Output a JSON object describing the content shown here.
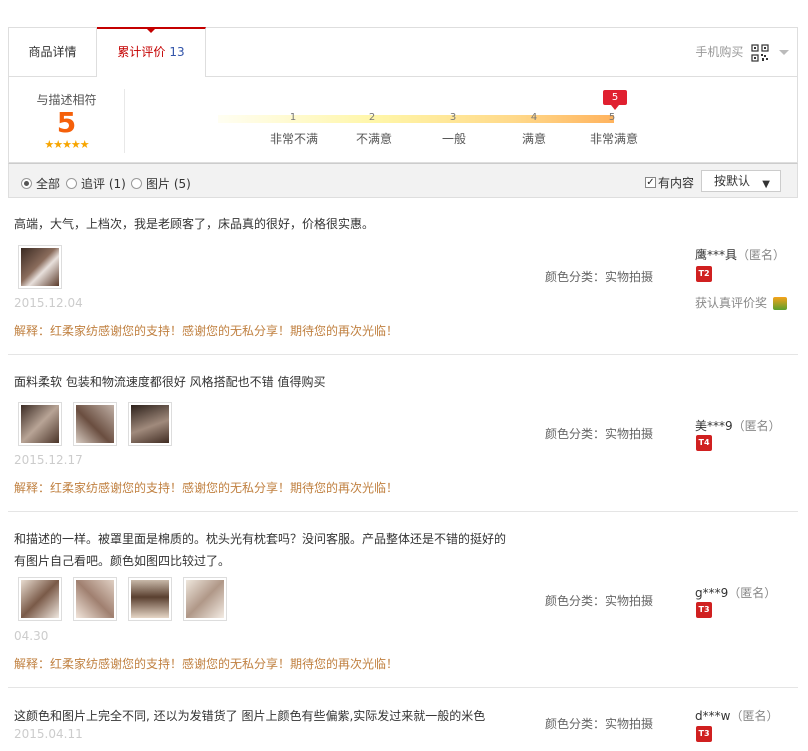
{
  "tabs": {
    "detail": "商品详情",
    "reviews": "累计评价",
    "review_count": "13",
    "mobile": "手机购买"
  },
  "rating": {
    "label": "与描述相符",
    "score": "5",
    "stars": "★★★★★",
    "marker": "5",
    "scale_numbers": [
      "1",
      "2",
      "3",
      "4",
      "5"
    ],
    "scale_labels": [
      "非常不满",
      "不满意",
      "一般",
      "满意",
      "非常满意"
    ]
  },
  "filter": {
    "all": "全部",
    "followup": "追评 (1)",
    "pictures": "图片 (5)",
    "has_content": "有内容",
    "sort": "按默认"
  },
  "reviews": [
    {
      "text": "高端，大气，上档次，我是老顾客了，床品真的很好，价格很实惠。",
      "date": "2015.12.04",
      "reply": "解释：红柔家纺感谢您的支持！感谢您的无私分享！期待您的再次光临！",
      "color": "颜色分类：实物拍摄",
      "user": "鹰***具",
      "anon": "（匿名）",
      "level": "T2",
      "award": "获认真评价奖"
    },
    {
      "text": "面料柔软 包装和物流速度都很好 风格搭配也不错 值得购买",
      "date": "2015.12.17",
      "reply": "解释：红柔家纺感谢您的支持！感谢您的无私分享！期待您的再次光临！",
      "color": "颜色分类：实物拍摄",
      "user": "美***9",
      "anon": "（匿名）",
      "level": "T4"
    },
    {
      "text": "和描述的一样。被罩里面是棉质的。枕头光有枕套吗？没问客服。产品整体还是不错的挺好的有图片自己看吧。颜色如图四比较过了。",
      "date": "04.30",
      "reply": "解释：红柔家纺感谢您的支持！感谢您的无私分享！期待您的再次光临！",
      "color": "颜色分类：实物拍摄",
      "user": "g***9",
      "anon": "（匿名）",
      "level": "T3"
    },
    {
      "text": "这颜色和图片上完全不同, 还以为发错货了 图片上颜色有些偏紫,实际发过来就一般的米色",
      "date": "2015.04.11",
      "color": "颜色分类：实物拍摄",
      "user": "d***w",
      "anon": "（匿名）",
      "level": "T3"
    }
  ]
}
